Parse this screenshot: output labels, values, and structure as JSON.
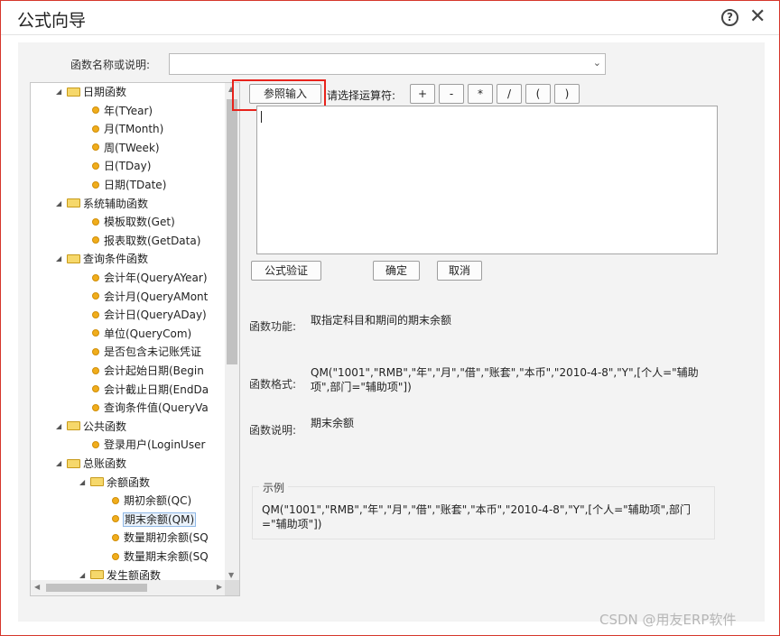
{
  "dialog": {
    "title": "公式向导",
    "help_icon": "?",
    "close_icon": "✕"
  },
  "search": {
    "label": "函数名称或说明:",
    "value": ""
  },
  "tree": {
    "items": [
      {
        "label": "日期函数",
        "kind": "folder",
        "depth": 0
      },
      {
        "label": "年(TYear)",
        "kind": "leaf",
        "depth": 1
      },
      {
        "label": "月(TMonth)",
        "kind": "leaf",
        "depth": 1
      },
      {
        "label": "周(TWeek)",
        "kind": "leaf",
        "depth": 1
      },
      {
        "label": "日(TDay)",
        "kind": "leaf",
        "depth": 1
      },
      {
        "label": "日期(TDate)",
        "kind": "leaf",
        "depth": 1
      },
      {
        "label": "系统辅助函数",
        "kind": "folder",
        "depth": 0
      },
      {
        "label": "模板取数(Get)",
        "kind": "leaf",
        "depth": 1
      },
      {
        "label": "报表取数(GetData)",
        "kind": "leaf",
        "depth": 1
      },
      {
        "label": "查询条件函数",
        "kind": "folder",
        "depth": 0
      },
      {
        "label": "会计年(QueryAYear)",
        "kind": "leaf",
        "depth": 1
      },
      {
        "label": "会计月(QueryAMont",
        "kind": "leaf",
        "depth": 1
      },
      {
        "label": "会计日(QueryADay)",
        "kind": "leaf",
        "depth": 1
      },
      {
        "label": "单位(QueryCom)",
        "kind": "leaf",
        "depth": 1
      },
      {
        "label": "是否包含未记账凭证",
        "kind": "leaf",
        "depth": 1
      },
      {
        "label": "会计起始日期(Begin",
        "kind": "leaf",
        "depth": 1
      },
      {
        "label": "会计截止日期(EndDa",
        "kind": "leaf",
        "depth": 1
      },
      {
        "label": "查询条件值(QueryVa",
        "kind": "leaf",
        "depth": 1
      },
      {
        "label": "公共函数",
        "kind": "folder",
        "depth": 0
      },
      {
        "label": "登录用户(LoginUser",
        "kind": "leaf",
        "depth": 1
      },
      {
        "label": "总账函数",
        "kind": "folder",
        "depth": 0
      },
      {
        "label": "余额函数",
        "kind": "folder",
        "depth": 1
      },
      {
        "label": "期初余额(QC)",
        "kind": "leaf",
        "depth": 2
      },
      {
        "label": "期末余额(QM)",
        "kind": "leaf",
        "depth": 2,
        "selected": true
      },
      {
        "label": "数量期初余额(SQ",
        "kind": "leaf",
        "depth": 2
      },
      {
        "label": "数量期末余额(SQ",
        "kind": "leaf",
        "depth": 2
      },
      {
        "label": "发生额函数",
        "kind": "folder",
        "depth": 1
      }
    ]
  },
  "toolbar": {
    "ref_input": "参照输入",
    "operator_label": "请选择运算符:",
    "operators": [
      "+",
      "-",
      "*",
      "/",
      "(",
      ")"
    ]
  },
  "formula": {
    "value": ""
  },
  "actions": {
    "verify": "公式验证",
    "ok": "确定",
    "cancel": "取消"
  },
  "info": {
    "function_label": "函数功能:",
    "function_value": "取指定科目和期间的期末余额",
    "format_label": "函数格式:",
    "format_value": "QM(\"1001\",\"RMB\",\"年\",\"月\",\"借\",\"账套\",\"本币\",\"2010-4-8\",\"Y\",[个人=\"辅助项\",部门=\"辅助项\"])",
    "desc_label": "函数说明:",
    "desc_value": "期末余额"
  },
  "example": {
    "legend": "示例",
    "text": "QM(\"1001\",\"RMB\",\"年\",\"月\",\"借\",\"账套\",\"本币\",\"2010-4-8\",\"Y\",[个人=\"辅助项\",部门=\"辅助项\"])"
  },
  "watermark": "CSDN @用友ERP软件",
  "colors": {
    "highlight": "#e8231c",
    "dialog_border": "#d6362c",
    "leaf_dot": "#f0ad1c",
    "folder": "#f6d86b"
  }
}
